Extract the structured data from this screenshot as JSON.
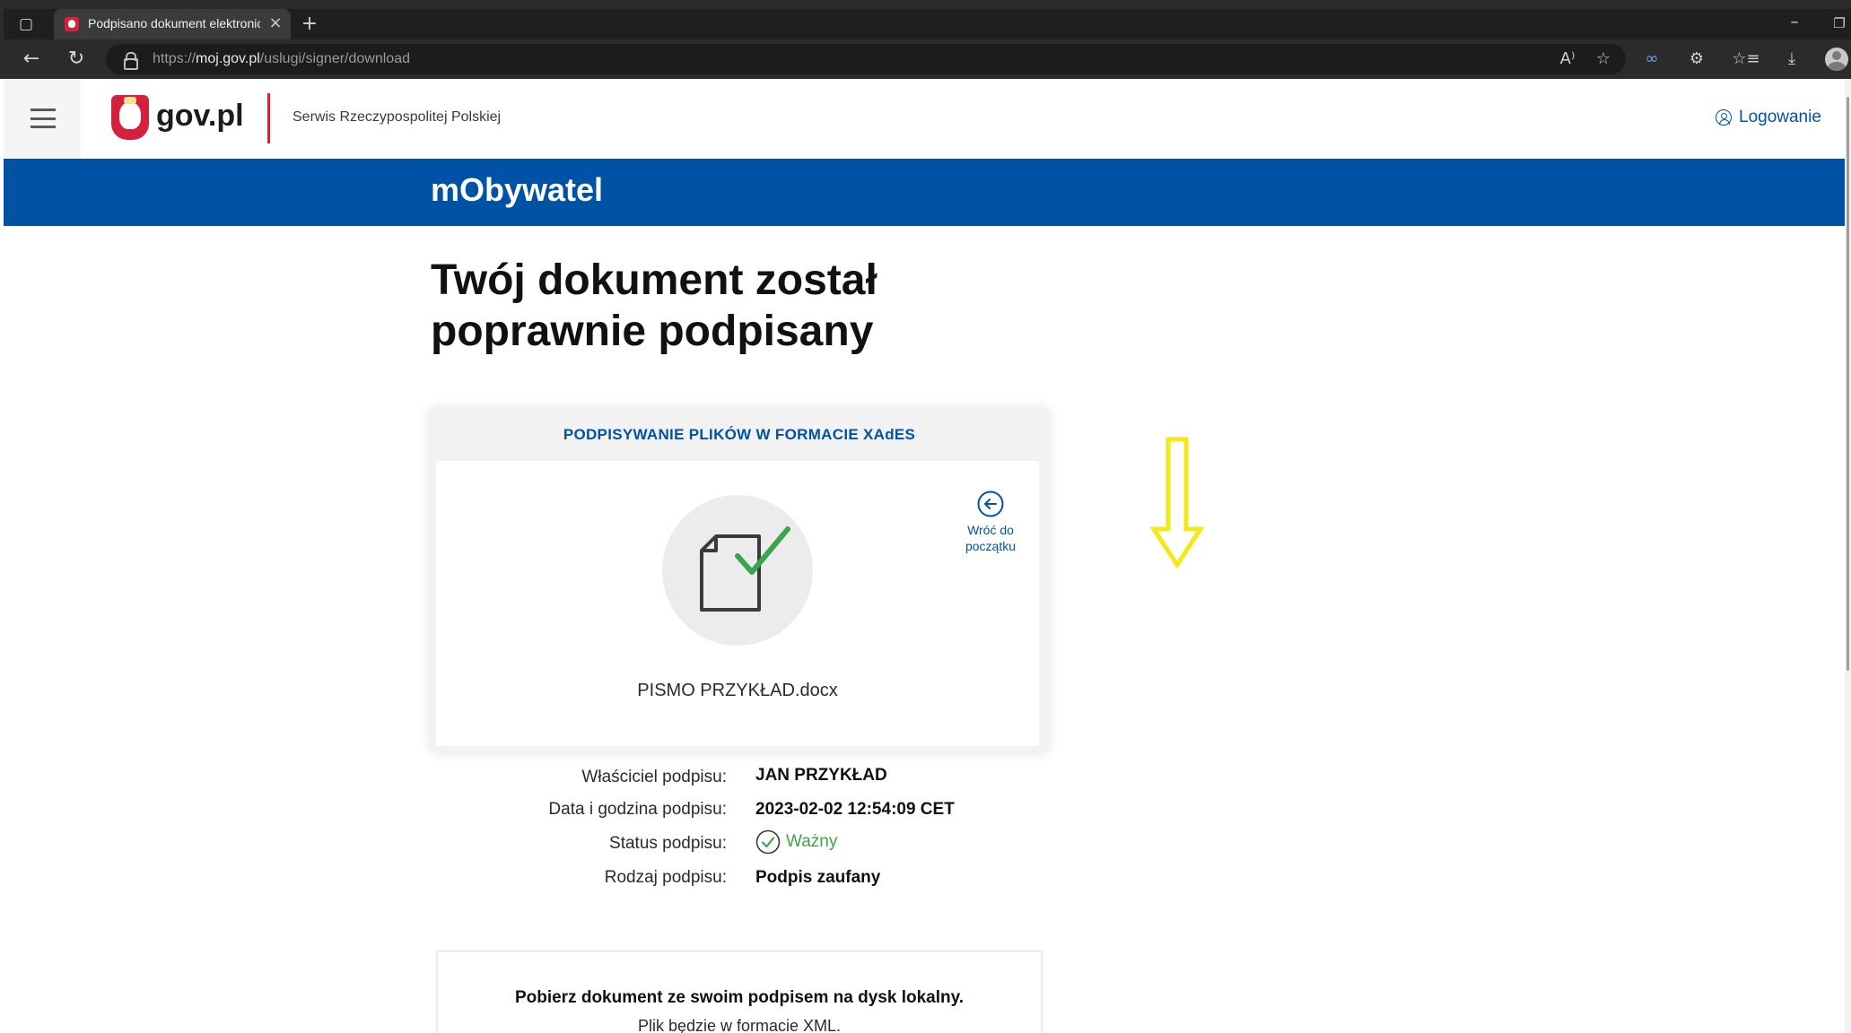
{
  "browser": {
    "tab_title": "Podpisano dokument elektronicz",
    "url_scheme": "https://",
    "url_host": "moj.gov.pl",
    "url_path": "/uslugi/signer/download",
    "icons": [
      "tab-actions-icon",
      "close-icon",
      "plus-icon",
      "minimize-icon",
      "restore-icon",
      "back-arrow-icon",
      "reload-icon",
      "lock-icon",
      "read-aloud-icon",
      "add-favorite-icon",
      "copilot-icon",
      "extensions-icon",
      "favorites-icon",
      "download-icon",
      "profile-icon"
    ],
    "read_aloud_glyph": "A⁾",
    "add_favorite_glyph": "☆",
    "copilot_glyph": "∞",
    "extensions_glyph": "⚙",
    "favorites_glyph": "☆≡",
    "download_glyph": "⤓"
  },
  "header": {
    "brand": "gov.pl",
    "service": "Serwis Rzeczypospolitej Polskiej",
    "login_label": "Logowanie"
  },
  "app_bar": {
    "title": "mObywatel"
  },
  "main": {
    "heading_line1": "Twój dokument został",
    "heading_line2": "poprawnie podpisany",
    "card": {
      "title": "PODPISYWANIE PLIKÓW W FORMACIE XAdES",
      "back_label_line1": "Wróć do",
      "back_label_line2": "początku",
      "file_name": "PISMO PRZYKŁAD.docx"
    },
    "details": {
      "owner_label": "Właściciel podpisu:",
      "owner_value": "JAN PRZYKŁAD",
      "date_label": "Data i godzina podpisu:",
      "date_value": "2023-02-02 12:54:09 CET",
      "status_label": "Status podpisu:",
      "status_value": "Ważny",
      "type_label": "Rodzaj podpisu:",
      "type_value": "Podpis zaufany"
    },
    "download": {
      "title": "Pobierz dokument ze swoim podpisem na dysk lokalny.",
      "subtitle": "Plik będzie w formacie XML."
    }
  },
  "colors": {
    "brand_blue": "#0052a5",
    "brand_red": "#d4213d",
    "success_green": "#3aa54a",
    "annotation_yellow": "#f2ea18"
  }
}
